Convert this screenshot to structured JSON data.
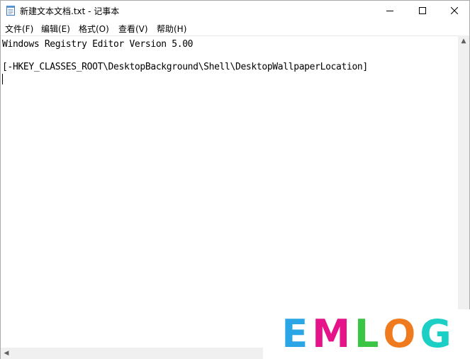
{
  "window": {
    "title": "新建文本文档.txt - 记事本"
  },
  "menu": [
    {
      "label": "文件(F)"
    },
    {
      "label": "编辑(E)"
    },
    {
      "label": "格式(O)"
    },
    {
      "label": "查看(V)"
    },
    {
      "label": "帮助(H)"
    }
  ],
  "editor": {
    "lines": [
      "Windows Registry Editor Version 5.00",
      "",
      "[-HKEY_CLASSES_ROOT\\DesktopBackground\\Shell\\DesktopWallpaperLocation]"
    ]
  },
  "watermark": {
    "letters": [
      "E",
      "M",
      "L",
      "O",
      "G"
    ],
    "colors": [
      "#2aa5e6",
      "#e5128a",
      "#3bc544",
      "#f07a1e",
      "#1ccfc4"
    ]
  },
  "icons": {
    "app": "notepad-icon",
    "minimize": "minimize-icon",
    "maximize": "maximize-icon",
    "close": "close-icon"
  }
}
